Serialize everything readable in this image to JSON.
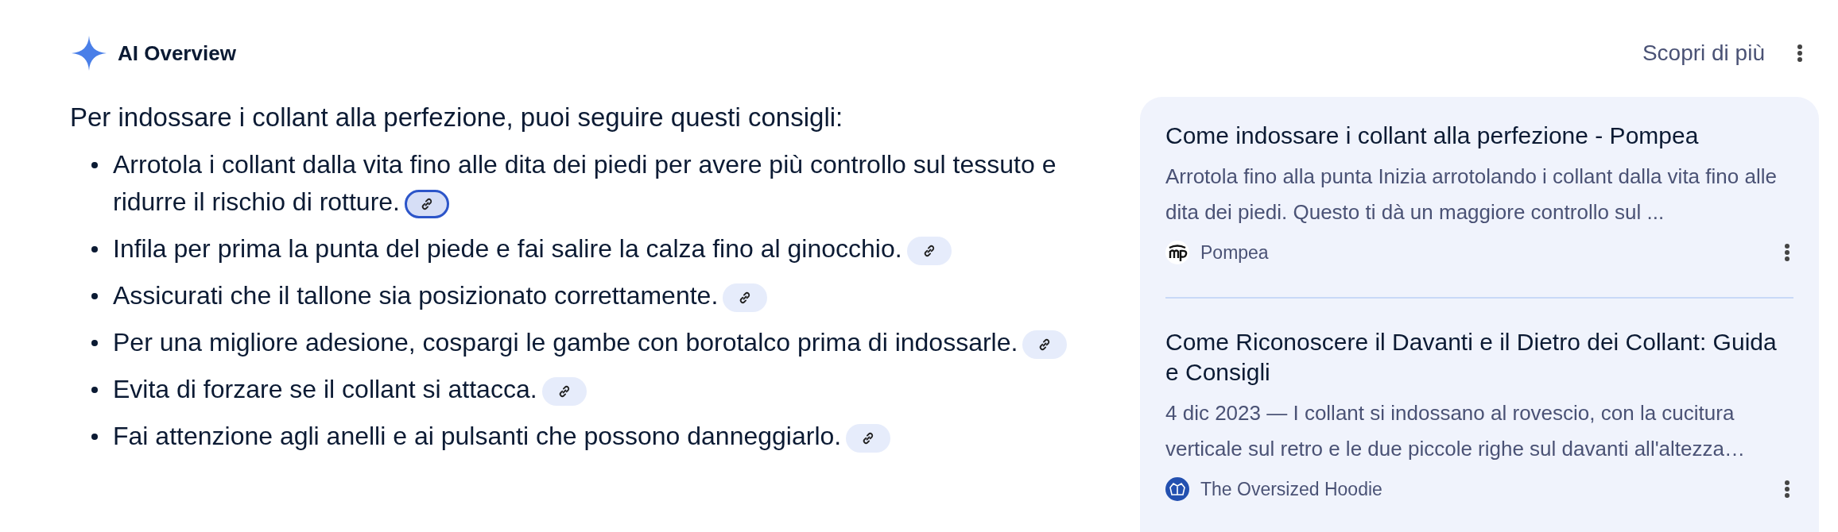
{
  "header": {
    "title": "AI Overview",
    "more_link": "Scopri di più"
  },
  "intro": "Per indossare i collant alla perfezione, puoi seguire questi consigli:",
  "points": [
    {
      "text": "Arrotola i collant dalla vita fino alle dita dei piedi per avere più controllo sul tessuto e ridurre il rischio di rotture.",
      "source_selected": true
    },
    {
      "text": "Infila per prima la punta del piede e fai salire la calza fino al ginocchio.",
      "source_selected": false
    },
    {
      "text": "Assicurati che il tallone sia posizionato correttamente.",
      "source_selected": false
    },
    {
      "text": "Per una migliore adesione, cospargi le gambe con borotalco prima di indossarle.",
      "source_selected": false
    },
    {
      "text": "Evita di forzare se il collant si attacca.",
      "source_selected": false
    },
    {
      "text": "Fai attenzione agli anelli e ai pulsanti che possono danneggiarlo.",
      "source_selected": false
    }
  ],
  "sources": [
    {
      "title": "Come indossare i collant alla perfezione - Pompea",
      "snippet": "Arrotola fino alla punta Inizia arrotolando i collant dalla vita fino alle dita dei piedi. Questo ti dà un maggiore controllo sul ...",
      "site": "Pompea"
    },
    {
      "title": "Come Riconoscere il Davanti e il Dietro dei Collant: Guida e Consigli",
      "snippet": "4 dic 2023 — I collant si indossano al rovescio, con la cucitura verticale sul retro e le due piccole righe sul davanti all'altezza…",
      "site": "The Oversized Hoodie"
    }
  ]
}
